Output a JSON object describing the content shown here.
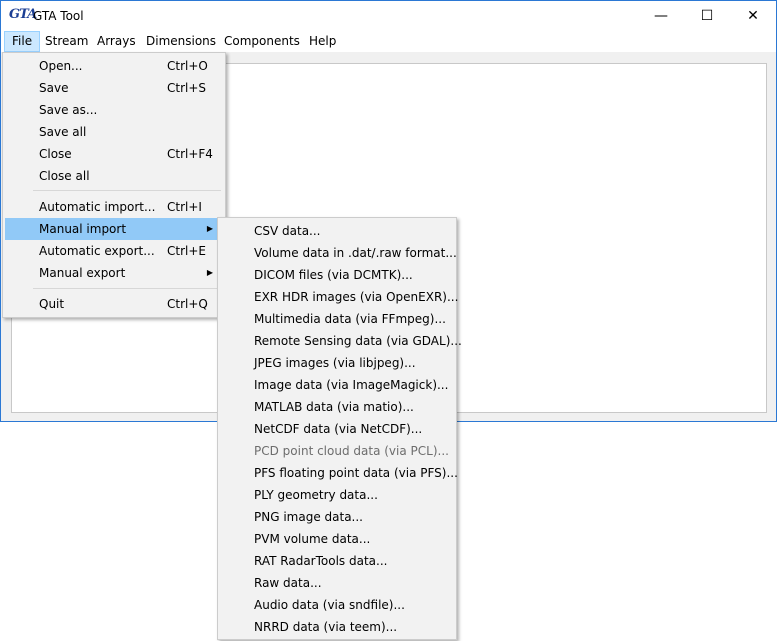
{
  "window": {
    "icon_text": "GTA",
    "title": "GTA Tool",
    "minimize_icon": "minimize-icon",
    "maximize_icon": "maximize-icon",
    "close_icon": "close-icon",
    "minimize_glyph": "—",
    "maximize_glyph": "☐",
    "close_glyph": "✕"
  },
  "menubar": [
    "File",
    "Stream",
    "Arrays",
    "Dimensions",
    "Components",
    "Help"
  ],
  "file_menu": [
    {
      "label": "Open...",
      "shortcut": "Ctrl+O"
    },
    {
      "label": "Save",
      "shortcut": "Ctrl+S"
    },
    {
      "label": "Save as...",
      "shortcut": ""
    },
    {
      "label": "Save all",
      "shortcut": ""
    },
    {
      "label": "Close",
      "shortcut": "Ctrl+F4"
    },
    {
      "label": "Close all",
      "shortcut": ""
    },
    {
      "label": "Automatic import...",
      "shortcut": "Ctrl+I"
    },
    {
      "label": "Manual import",
      "shortcut": "",
      "submenu": true,
      "highlighted": true
    },
    {
      "label": "Automatic export...",
      "shortcut": "Ctrl+E"
    },
    {
      "label": "Manual export",
      "shortcut": "",
      "submenu": true
    },
    {
      "label": "Quit",
      "shortcut": "Ctrl+Q"
    }
  ],
  "manual_import_menu": [
    {
      "label": "CSV data..."
    },
    {
      "label": "Volume data in .dat/.raw format..."
    },
    {
      "label": "DICOM files (via DCMTK)..."
    },
    {
      "label": "EXR HDR images (via OpenEXR)..."
    },
    {
      "label": "Multimedia data (via FFmpeg)..."
    },
    {
      "label": "Remote Sensing data (via GDAL)..."
    },
    {
      "label": "JPEG images (via libjpeg)..."
    },
    {
      "label": "Image data (via ImageMagick)..."
    },
    {
      "label": "MATLAB data (via matio)..."
    },
    {
      "label": "NetCDF data (via NetCDF)..."
    },
    {
      "label": "PCD point cloud data (via PCL)...",
      "disabled": true
    },
    {
      "label": "PFS floating point data (via PFS)..."
    },
    {
      "label": "PLY geometry data..."
    },
    {
      "label": "PNG image data..."
    },
    {
      "label": "PVM volume data..."
    },
    {
      "label": "RAT RadarTools data..."
    },
    {
      "label": "Raw data..."
    },
    {
      "label": "Audio data (via sndfile)..."
    },
    {
      "label": "NRRD data (via teem)..."
    }
  ],
  "colors": {
    "highlight": "#91c9f7",
    "menu_bg": "#f2f2f2",
    "active_menu": "#cce8ff",
    "disabled": "#6d6d6d"
  }
}
